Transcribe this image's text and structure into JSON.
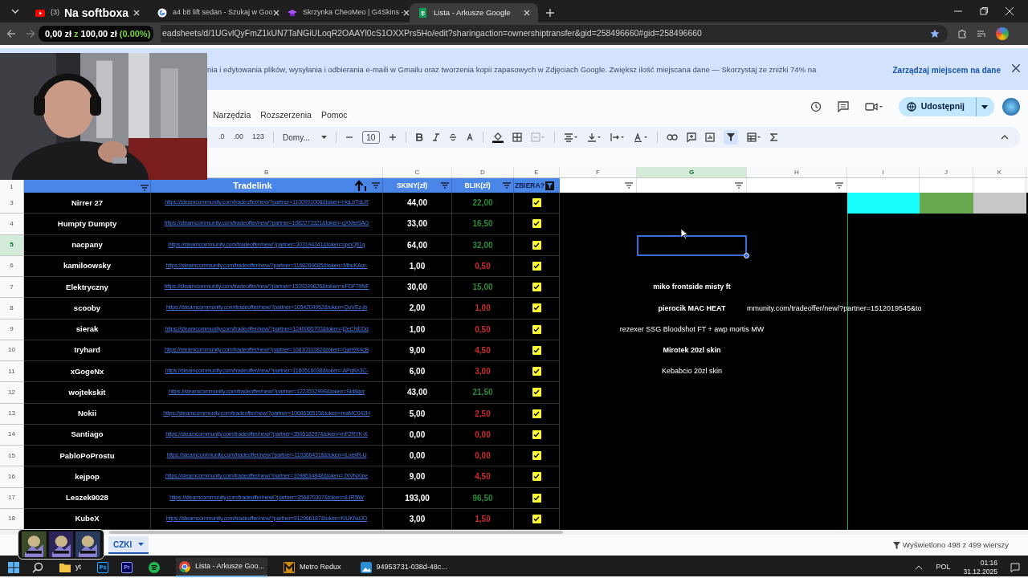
{
  "browser": {
    "tabs": [
      {
        "kind": "youtube",
        "title": "(3)",
        "selected": false
      },
      {
        "kind": "google",
        "title": "a4 b8 lift sedan - Szukaj w Goo",
        "selected": false
      },
      {
        "kind": "hat",
        "title": "Skrzynka CheoMeo | G4Skins -",
        "selected": false
      },
      {
        "kind": "sheets",
        "title": "Lista - Arkusze Google",
        "selected": true
      }
    ],
    "url": "eadsheets/d/1UGvlQyFmZ1kUN7TaNGiULoqR2OAAYl0cS1OXXPrs5Ho/edit?sharingaction=ownershiptransfer&gid=258496660#gid=258496660"
  },
  "stream_overlay": {
    "title": "Na softboxa",
    "raised": "0,00 zł",
    "separator": "z",
    "goal": "100,00 zł",
    "percent": "(0.00%)"
  },
  "banner": {
    "text": "nia i edytowania plików, wysyłania i odbierania e-maili w Gmailu oraz tworzenia kopii zapasowych w Zdjęciach Google. Zwiększ ilość miejscana dane — Skorzystaj ze zniżki 74% na",
    "action": "Zarządzaj miejscem na dane"
  },
  "menu": [
    "Narzędzia",
    "Rozszerzenia",
    "Pomoc"
  ],
  "share_button": "Udostępnij",
  "toolbar": {
    "decrease_decimals": ".0",
    "increase_decimals": ".00",
    "number_format": "123",
    "font": "Domy...",
    "font_size": "10",
    "filter_on": true
  },
  "columns": [
    {
      "letter": "B",
      "selected": false
    },
    {
      "letter": "C",
      "selected": false
    },
    {
      "letter": "D",
      "selected": false
    },
    {
      "letter": "E",
      "selected": false
    },
    {
      "letter": "F",
      "selected": false
    },
    {
      "letter": "G",
      "selected": true
    },
    {
      "letter": "H",
      "selected": false
    },
    {
      "letter": "I",
      "selected": false
    },
    {
      "letter": "J",
      "selected": false
    },
    {
      "letter": "K",
      "selected": false
    }
  ],
  "header_row": {
    "number": "1",
    "tradelink": "Tradelink",
    "skiny": "SKINY(zł)",
    "blik": "BLIK(zł)",
    "zbiera": "ZBIERA?",
    "zbiera_filter_on": true
  },
  "swatches": [
    {
      "color": "#19ffff"
    },
    {
      "color": "#6aa84f"
    },
    {
      "color": "#c8c8c8"
    }
  ],
  "rows": [
    {
      "number": "3",
      "name": "Nirrer 27",
      "link": "https://steamcommunity.com/tradeoffer/new/?partner=1100991008&token=HqLhTdLR",
      "skiny": "44,00",
      "blik": "22,00",
      "color": "#2e8b3a",
      "checked": true,
      "selected": false
    },
    {
      "number": "4",
      "name": "Humpty Dumpty",
      "link": "https://steamcommunity.com/tradeoffer/new/?partner=1082273321&token=qXMeiSAG",
      "skiny": "33,00",
      "blik": "16,50",
      "color": "#2e8b3a",
      "checked": true,
      "selected": false
    },
    {
      "number": "5",
      "name": "nacpany",
      "link": "https://steamcommunity.com/tradeoffer/new/?partner=303194341&token=qxnQfI1q",
      "skiny": "64,00",
      "blik": "32,00",
      "color": "#2e8b3a",
      "checked": true,
      "selected": true
    },
    {
      "number": "6",
      "name": "kamiloowsky",
      "link": "https://steamcommunity.com/tradeoffer/new/?partner=1168269685&token=MbuKAor-",
      "skiny": "1,00",
      "blik": "0,50",
      "color": "#cc2929",
      "checked": true,
      "selected": false
    },
    {
      "number": "7",
      "name": "Elektryczny",
      "link": "https://steamcommunity.com/tradeoffer/new/?partner=1539249826&token=eFDF79NF",
      "skiny": "30,00",
      "blik": "15,00",
      "color": "#2e8b3a",
      "checked": true,
      "selected": false,
      "note": {
        "text": "miko frontside misty ft",
        "bold": true
      }
    },
    {
      "number": "8",
      "name": "scooby",
      "link": "https://steamcommunity.com/tradeoffer/new/?partner=1054204952&token=QuVEz-jb",
      "skiny": "2,00",
      "blik": "1,00",
      "color": "#cc2929",
      "checked": true,
      "selected": false,
      "note": {
        "text": "pierocik MAC HEAT",
        "bold": true
      },
      "overflow": "mmunity.com/tradeoffer/new/?partner=1512019545&to"
    },
    {
      "number": "9",
      "name": "sierak",
      "link": "https://steamcommunity.com/tradeoffer/new/?partner=1240065703&token=j2eCNEDd",
      "skiny": "1,00",
      "blik": "0,50",
      "color": "#cc2929",
      "checked": true,
      "selected": false,
      "note": {
        "text": "rezexer SSG Bloodshot FT + awp mortis MW",
        "bold": false
      }
    },
    {
      "number": "10",
      "name": "tryhard",
      "link": "https://steamcommunity.com/tradeoffer/new/?partner=1081031082&token=Gah9X4cB",
      "skiny": "9,00",
      "blik": "4,50",
      "color": "#cc2929",
      "checked": true,
      "selected": false,
      "note": {
        "text": "Mirotek 20zl skin",
        "bold": true
      }
    },
    {
      "number": "11",
      "name": "xGogeNx",
      "link": "https://steamcommunity.com/tradeoffer/new/?partner=1160516038&token=APqKn3C-",
      "skiny": "6,00",
      "blik": "3,00",
      "color": "#cc2929",
      "checked": true,
      "selected": false,
      "note": {
        "text": "Kebabcio 20zl skin",
        "bold": false
      }
    },
    {
      "number": "12",
      "name": "wojtekskit",
      "link": "https://steamcommunity.com/tradeoffer/new/?partner=1223532999&token=Sid8gcr",
      "skiny": "43,00",
      "blik": "21,50",
      "color": "#2e8b3a",
      "checked": true,
      "selected": false
    },
    {
      "number": "13",
      "name": "Nokii",
      "link": "https://steamcommunity.com/tradeoffer/new/?partner=1068636515&token=maMC042H",
      "skiny": "5,00",
      "blik": "2,50",
      "color": "#cc2929",
      "checked": true,
      "selected": false
    },
    {
      "number": "14",
      "name": "Santiago",
      "link": "https://steamcommunity.com/tradeoffer/new/?partner=350618297&token=mF2RYK-K",
      "skiny": "0,00",
      "blik": "0,00",
      "color": "#cc2929",
      "checked": true,
      "selected": false
    },
    {
      "number": "15",
      "name": "PabloPoProstu",
      "link": "https://steamcommunity.com/tradeoffer/new/?partner=1103664316&token=rLvekR-U",
      "skiny": "0,00",
      "blik": "0,00",
      "color": "#cc2929",
      "checked": true,
      "selected": false
    },
    {
      "number": "16",
      "name": "kejpop",
      "link": "https://steamcommunity.com/tradeoffer/new/?partner=1098634848&token=JXVNXjne",
      "skiny": "9,00",
      "blik": "4,50",
      "color": "#cc2929",
      "checked": true,
      "selected": false
    },
    {
      "number": "17",
      "name": "Leszek9028",
      "link": "https://steamcommunity.com/tradeoffer/new/?partner=356870307&token=8-IR5lW",
      "skiny": "193,00",
      "blik": "96,50",
      "color": "#2e8b3a",
      "checked": true,
      "selected": false
    },
    {
      "number": "18",
      "name": "KubeX",
      "link": "https://steamcommunity.com/tradeoffer/new/?partner=912966187&token=KiUKNdJO",
      "skiny": "3,00",
      "blik": "1,50",
      "color": "#cc2929",
      "checked": true,
      "selected": false
    }
  ],
  "sheet_tab": "CZKI",
  "status": "Wyświetlono 498 z 499 wierszy",
  "taskbar": {
    "apps": [
      {
        "kind": "folder",
        "label": "yt"
      },
      {
        "kind": "photoshop",
        "label": "Ps"
      },
      {
        "kind": "premiere",
        "label": "Pr"
      },
      {
        "kind": "spotify"
      },
      {
        "kind": "chrome",
        "label": "Lista - Arkusze Goo..."
      },
      {
        "kind": "metro",
        "label": "Metro Redux"
      },
      {
        "label": "94953731-038d-48c..."
      }
    ],
    "language": "POL",
    "time": "01:16",
    "date": "31.12.2025"
  }
}
